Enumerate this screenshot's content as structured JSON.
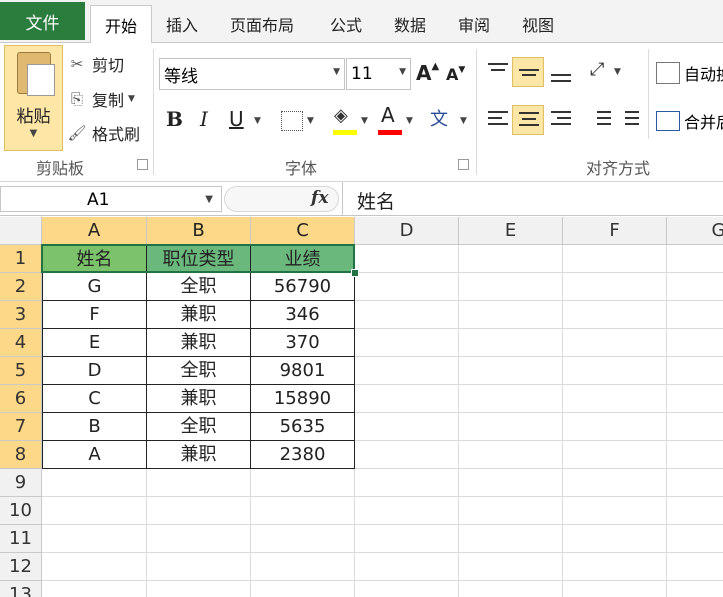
{
  "ribbon_tabs": {
    "file": "文件",
    "home": "开始",
    "insert": "插入",
    "page_layout": "页面布局",
    "formulas": "公式",
    "data": "数据",
    "review": "审阅",
    "view": "视图"
  },
  "clipboard": {
    "paste": "粘贴",
    "cut": "剪切",
    "copy": "复制",
    "format_painter": "格式刷",
    "group_label": "剪贴板"
  },
  "font": {
    "family": "等线",
    "size": "11",
    "bold": "B",
    "italic": "I",
    "underline": "U",
    "fill_color": "#ffff00",
    "font_color": "#ff0000",
    "group_label": "字体"
  },
  "alignment": {
    "wrap_text": "自动换",
    "merge_center": "合并后",
    "group_label": "对齐方式"
  },
  "formula_bar": {
    "name_box": "A1",
    "fx": "fx",
    "content": "姓名"
  },
  "columns": [
    "A",
    "B",
    "C",
    "D",
    "E",
    "F",
    "G"
  ],
  "rows": [
    "1",
    "2",
    "3",
    "4",
    "5",
    "6",
    "7",
    "8",
    "9",
    "10",
    "11",
    "12",
    "13"
  ],
  "table": {
    "header": [
      "姓名",
      "职位类型",
      "业绩"
    ],
    "rows": [
      [
        "G",
        "全职",
        "56790"
      ],
      [
        "F",
        "兼职",
        "346"
      ],
      [
        "E",
        "兼职",
        "370"
      ],
      [
        "D",
        "全职",
        "9801"
      ],
      [
        "C",
        "兼职",
        "15890"
      ],
      [
        "B",
        "全职",
        "5635"
      ],
      [
        "A",
        "兼职",
        "2380"
      ]
    ]
  }
}
